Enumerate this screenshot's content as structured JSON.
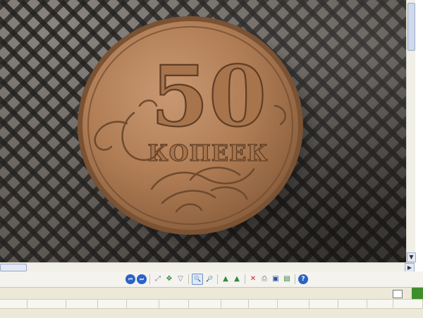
{
  "coin": {
    "denomination": "50",
    "word": "КОПЕЕК"
  },
  "toolbar": {
    "buttons": [
      {
        "icon": "previous-image-icon",
        "glyph": "⏮"
      },
      {
        "icon": "next-image-icon",
        "glyph": "⏭"
      },
      {
        "icon": "fit-to-window-icon",
        "glyph": "⤢"
      },
      {
        "icon": "actual-size-icon",
        "glyph": "✥"
      },
      {
        "icon": "slideshow-icon",
        "glyph": "▽"
      },
      {
        "icon": "zoom-in-icon",
        "glyph": "🔍"
      },
      {
        "icon": "zoom-out-icon",
        "glyph": "🔎"
      },
      {
        "icon": "rotate-clockwise-icon",
        "glyph": "▲"
      },
      {
        "icon": "rotate-counterclockwise-icon",
        "glyph": "▲"
      },
      {
        "icon": "delete-icon",
        "glyph": "✕"
      },
      {
        "icon": "print-icon",
        "glyph": "⎙"
      },
      {
        "icon": "save-icon",
        "glyph": "▣"
      },
      {
        "icon": "open-in-editor-icon",
        "glyph": "▤"
      },
      {
        "icon": "help-icon",
        "glyph": "?"
      }
    ]
  },
  "colors": {
    "coin_face": "#b5825a",
    "coin_rim": "#8a5e3c",
    "relief": "#6e4a2e",
    "toolbar_blue": "#2a63c8"
  }
}
